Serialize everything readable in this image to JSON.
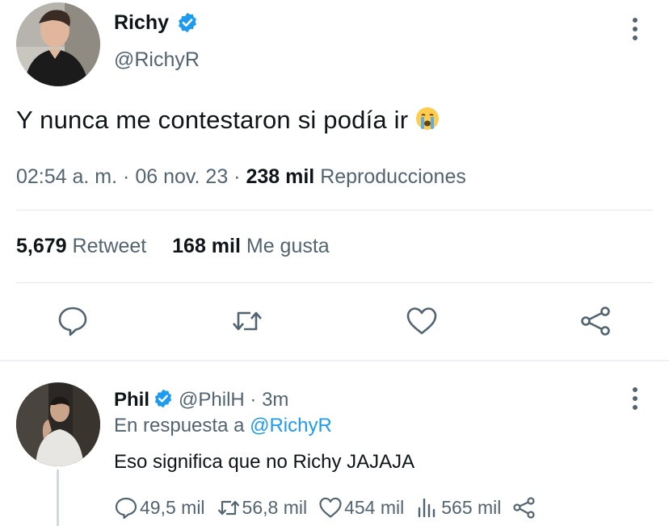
{
  "main_tweet": {
    "author_name": "Richy",
    "handle": "@RichyR",
    "text": "Y nunca me contestaron si podía ir",
    "emoji_icon": "loudly-crying-face-icon",
    "time": "02:54 a. m.",
    "date": "06 nov. 23",
    "views_count": "238 mil",
    "views_label": "Reproducciones",
    "retweets_count": "5,679",
    "retweets_label": "Retweet",
    "likes_count": "168 mil",
    "likes_label": "Me gusta",
    "separator": "·"
  },
  "reply": {
    "author_name": "Phil",
    "handle": "@PhilH",
    "time_ago": "3m",
    "separator": "·",
    "in_reply_prefix": "En respuesta a",
    "in_reply_mention": "@RichyR",
    "text": "Eso significa que no Richy JAJAJA",
    "replies": "49,5 mil",
    "retweets": "56,8 mil",
    "likes": "454 mil",
    "views": "565 mil"
  },
  "colors": {
    "accent": "#1d9bf0",
    "text": "#0f1419",
    "muted": "#536471",
    "divider": "#e1e6ea"
  }
}
